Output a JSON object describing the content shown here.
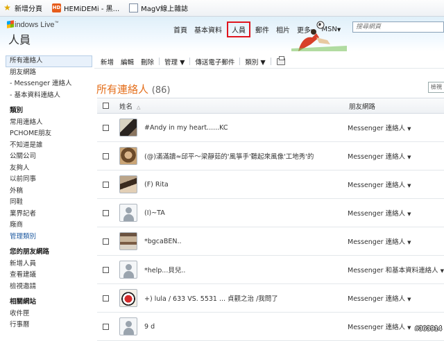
{
  "favorites": [
    {
      "label": "新增分頁",
      "icon": "star-icon"
    },
    {
      "label": "HEMiDEMi - 黑...",
      "icon": "hemidemi-icon"
    },
    {
      "label": "MagV線上雜誌",
      "icon": "page-icon"
    }
  ],
  "header": {
    "logo_text": "indows Live",
    "logo_tm": "™",
    "app_title": "人員",
    "nav": [
      {
        "label": "首頁",
        "active": false,
        "caret": false
      },
      {
        "label": "基本資料",
        "active": false,
        "caret": false
      },
      {
        "label": "人員",
        "active": true,
        "caret": false
      },
      {
        "label": "郵件",
        "active": false,
        "caret": false
      },
      {
        "label": "相片",
        "active": false,
        "caret": false
      },
      {
        "label": "更多",
        "active": false,
        "caret": true
      },
      {
        "label": "MSN",
        "active": false,
        "caret": true
      }
    ],
    "caret_symbol": "▼",
    "search_placeholder": "搜尋網頁"
  },
  "sidebar": {
    "items": [
      {
        "label": "所有連絡人",
        "selected": true
      },
      {
        "label": "朋友網路"
      },
      {
        "label": "- Messenger 連絡人"
      },
      {
        "label": "- 基本資料連絡人"
      }
    ],
    "sections": [
      {
        "heading": "類別",
        "items": [
          "常用連絡人",
          "PCHOME朋友",
          "不知道是誰",
          "公關公司",
          "友夠人",
          "以前同事",
          "外稿",
          "同鞋",
          "業界記者",
          "廠商",
          "管理類別"
        ]
      },
      {
        "heading": "您的朋友網路",
        "items": [
          "新增人員",
          "查看建議",
          "檢視邀請"
        ]
      },
      {
        "heading": "相關網站",
        "items": [
          "收件匣",
          "行事曆"
        ]
      }
    ]
  },
  "toolbar": {
    "new": "新增",
    "edit": "編輯",
    "delete": "刪除",
    "manage": "管理 ▼",
    "send_email": "傳送電子郵件",
    "category": "類別 ▼"
  },
  "main": {
    "title": "所有連絡人",
    "count": "(86)",
    "right_button": "檢視"
  },
  "table": {
    "col_name": "姓名",
    "col_name_sort": "△",
    "col_network": "朋友網路",
    "rows": [
      {
        "name": "#Andy in my heart......KC",
        "network": "Messenger 連絡人",
        "avatar": "photo1"
      },
      {
        "name": "(@)滿滿讀≈邱平～梁靜茹的'風箏手'聽起來風像'工地秀'的",
        "network": "Messenger 連絡人",
        "avatar": "photo2"
      },
      {
        "name": "(F) Rita",
        "network": "Messenger 連絡人",
        "avatar": "photo3"
      },
      {
        "name": "(I)~TA",
        "network": "Messenger 連絡人",
        "avatar": "default"
      },
      {
        "name": "*bgcaBEN..",
        "network": "Messenger 連絡人",
        "avatar": "photo4"
      },
      {
        "name": "*help...貝兒..",
        "network": "Messenger 和基本資料連絡人",
        "avatar": "default"
      },
      {
        "name": "+) lula / 633 VS. 5531 ... 貞觀之治 /我問了",
        "network": "Messenger 連絡人",
        "avatar": "photo5"
      },
      {
        "name": "9 d",
        "network": "Messenger 連絡人",
        "avatar": "default"
      }
    ]
  },
  "watermark": "#363914"
}
